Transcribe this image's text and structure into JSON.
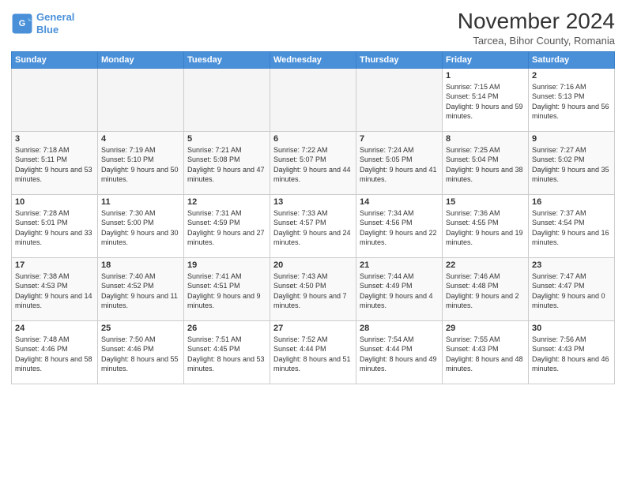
{
  "logo": {
    "line1": "General",
    "line2": "Blue"
  },
  "title": "November 2024",
  "subtitle": "Tarcea, Bihor County, Romania",
  "weekdays": [
    "Sunday",
    "Monday",
    "Tuesday",
    "Wednesday",
    "Thursday",
    "Friday",
    "Saturday"
  ],
  "weeks": [
    [
      {
        "day": "",
        "info": ""
      },
      {
        "day": "",
        "info": ""
      },
      {
        "day": "",
        "info": ""
      },
      {
        "day": "",
        "info": ""
      },
      {
        "day": "",
        "info": ""
      },
      {
        "day": "1",
        "info": "Sunrise: 7:15 AM\nSunset: 5:14 PM\nDaylight: 9 hours and 59 minutes."
      },
      {
        "day": "2",
        "info": "Sunrise: 7:16 AM\nSunset: 5:13 PM\nDaylight: 9 hours and 56 minutes."
      }
    ],
    [
      {
        "day": "3",
        "info": "Sunrise: 7:18 AM\nSunset: 5:11 PM\nDaylight: 9 hours and 53 minutes."
      },
      {
        "day": "4",
        "info": "Sunrise: 7:19 AM\nSunset: 5:10 PM\nDaylight: 9 hours and 50 minutes."
      },
      {
        "day": "5",
        "info": "Sunrise: 7:21 AM\nSunset: 5:08 PM\nDaylight: 9 hours and 47 minutes."
      },
      {
        "day": "6",
        "info": "Sunrise: 7:22 AM\nSunset: 5:07 PM\nDaylight: 9 hours and 44 minutes."
      },
      {
        "day": "7",
        "info": "Sunrise: 7:24 AM\nSunset: 5:05 PM\nDaylight: 9 hours and 41 minutes."
      },
      {
        "day": "8",
        "info": "Sunrise: 7:25 AM\nSunset: 5:04 PM\nDaylight: 9 hours and 38 minutes."
      },
      {
        "day": "9",
        "info": "Sunrise: 7:27 AM\nSunset: 5:02 PM\nDaylight: 9 hours and 35 minutes."
      }
    ],
    [
      {
        "day": "10",
        "info": "Sunrise: 7:28 AM\nSunset: 5:01 PM\nDaylight: 9 hours and 33 minutes."
      },
      {
        "day": "11",
        "info": "Sunrise: 7:30 AM\nSunset: 5:00 PM\nDaylight: 9 hours and 30 minutes."
      },
      {
        "day": "12",
        "info": "Sunrise: 7:31 AM\nSunset: 4:59 PM\nDaylight: 9 hours and 27 minutes."
      },
      {
        "day": "13",
        "info": "Sunrise: 7:33 AM\nSunset: 4:57 PM\nDaylight: 9 hours and 24 minutes."
      },
      {
        "day": "14",
        "info": "Sunrise: 7:34 AM\nSunset: 4:56 PM\nDaylight: 9 hours and 22 minutes."
      },
      {
        "day": "15",
        "info": "Sunrise: 7:36 AM\nSunset: 4:55 PM\nDaylight: 9 hours and 19 minutes."
      },
      {
        "day": "16",
        "info": "Sunrise: 7:37 AM\nSunset: 4:54 PM\nDaylight: 9 hours and 16 minutes."
      }
    ],
    [
      {
        "day": "17",
        "info": "Sunrise: 7:38 AM\nSunset: 4:53 PM\nDaylight: 9 hours and 14 minutes."
      },
      {
        "day": "18",
        "info": "Sunrise: 7:40 AM\nSunset: 4:52 PM\nDaylight: 9 hours and 11 minutes."
      },
      {
        "day": "19",
        "info": "Sunrise: 7:41 AM\nSunset: 4:51 PM\nDaylight: 9 hours and 9 minutes."
      },
      {
        "day": "20",
        "info": "Sunrise: 7:43 AM\nSunset: 4:50 PM\nDaylight: 9 hours and 7 minutes."
      },
      {
        "day": "21",
        "info": "Sunrise: 7:44 AM\nSunset: 4:49 PM\nDaylight: 9 hours and 4 minutes."
      },
      {
        "day": "22",
        "info": "Sunrise: 7:46 AM\nSunset: 4:48 PM\nDaylight: 9 hours and 2 minutes."
      },
      {
        "day": "23",
        "info": "Sunrise: 7:47 AM\nSunset: 4:47 PM\nDaylight: 9 hours and 0 minutes."
      }
    ],
    [
      {
        "day": "24",
        "info": "Sunrise: 7:48 AM\nSunset: 4:46 PM\nDaylight: 8 hours and 58 minutes."
      },
      {
        "day": "25",
        "info": "Sunrise: 7:50 AM\nSunset: 4:46 PM\nDaylight: 8 hours and 55 minutes."
      },
      {
        "day": "26",
        "info": "Sunrise: 7:51 AM\nSunset: 4:45 PM\nDaylight: 8 hours and 53 minutes."
      },
      {
        "day": "27",
        "info": "Sunrise: 7:52 AM\nSunset: 4:44 PM\nDaylight: 8 hours and 51 minutes."
      },
      {
        "day": "28",
        "info": "Sunrise: 7:54 AM\nSunset: 4:44 PM\nDaylight: 8 hours and 49 minutes."
      },
      {
        "day": "29",
        "info": "Sunrise: 7:55 AM\nSunset: 4:43 PM\nDaylight: 8 hours and 48 minutes."
      },
      {
        "day": "30",
        "info": "Sunrise: 7:56 AM\nSunset: 4:43 PM\nDaylight: 8 hours and 46 minutes."
      }
    ]
  ]
}
